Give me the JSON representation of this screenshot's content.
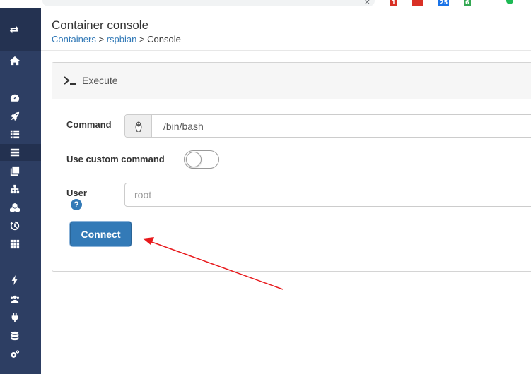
{
  "browser": {
    "badges": [
      "1",
      "25",
      "6"
    ]
  },
  "header": {
    "title": "Container console",
    "breadcrumb": {
      "root": "Containers",
      "sep1": " > ",
      "item": "rspbian",
      "sep2": " > ",
      "current": "Console"
    }
  },
  "sidebar": {
    "icons": [
      "exchange-icon",
      "home-icon",
      "dashboard-icon",
      "rocket-icon",
      "list-icon",
      "containers-icon",
      "images-icon",
      "networks-icon",
      "volumes-icon",
      "history-icon",
      "grid-icon",
      "bolt-icon",
      "users-icon",
      "plug-icon",
      "database-icon",
      "cogs-icon"
    ]
  },
  "widget": {
    "title": "Execute",
    "command_label": "Command",
    "command_value": "/bin/bash",
    "custom_command_label": "Use custom command",
    "custom_command_enabled": false,
    "user_label": "User",
    "user_placeholder": "root",
    "help_glyph": "?",
    "connect_label": "Connect"
  },
  "colors": {
    "sidebar": "#2d3e63",
    "primary": "#337ab7",
    "annotation_arrow": "#e8191c"
  }
}
